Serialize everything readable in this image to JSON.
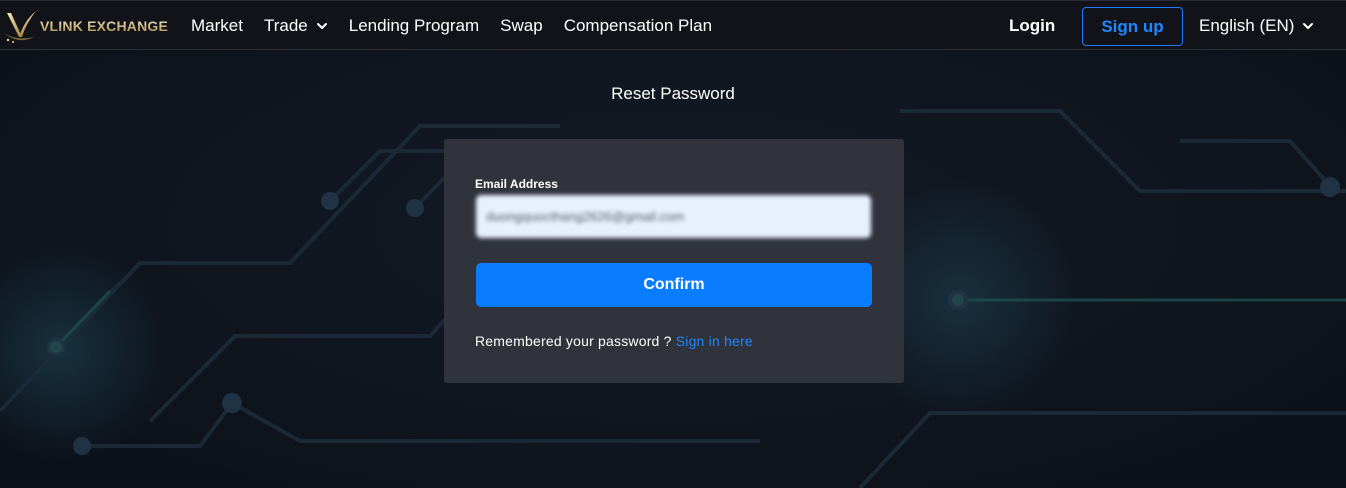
{
  "header": {
    "logo_text": "VLINK EXCHANGE",
    "nav": [
      {
        "label": "Market"
      },
      {
        "label": "Trade"
      },
      {
        "label": "Lending Program"
      },
      {
        "label": "Swap"
      },
      {
        "label": "Compensation Plan"
      }
    ],
    "login_label": "Login",
    "signup_label": "Sign up",
    "language_label": "English (EN)"
  },
  "page": {
    "title": "Reset Password"
  },
  "form": {
    "email_label": "Email Address",
    "email_value": "duongquocthang2626@gmail.com",
    "confirm_label": "Confirm",
    "remember_text": "Remembered your password ?",
    "signin_link_label": "Sign in here"
  },
  "colors": {
    "accent": "#0a7cff",
    "link": "#1f86ff",
    "card_bg": "#30333c",
    "nav_bg": "#111318",
    "page_bg": "#0f141d"
  }
}
